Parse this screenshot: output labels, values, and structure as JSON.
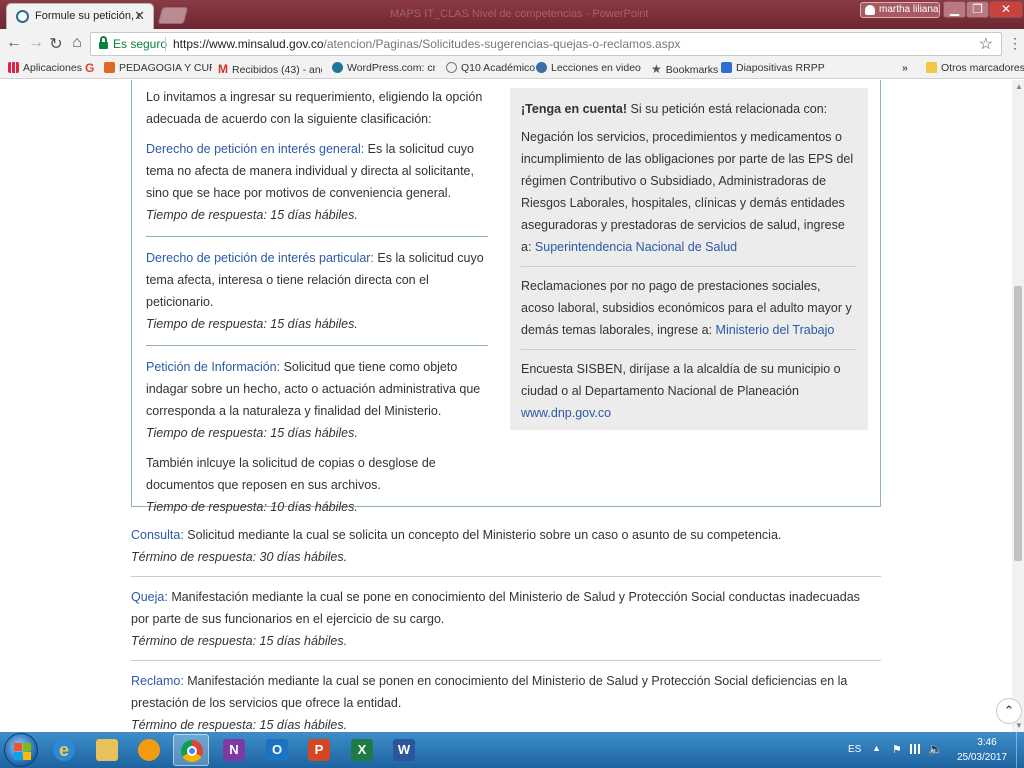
{
  "browser": {
    "tab_title": "Formule su petición, que",
    "tab_close": "✕",
    "window_ghost_text": "MAPS IT_CLAS Nivel de competencias - PowerPoint",
    "user_name": "martha liliana",
    "minimize": "▁",
    "maximize": "❐",
    "close": "✕",
    "back": "←",
    "forward": "→",
    "reload": "↻",
    "home": "⌂",
    "secure_label": "Es seguro",
    "url_host": "https://www.minsalud.gov.co",
    "url_path": "/atencion/Paginas/Solicitudes-sugerencias-quejas-o-reclamos.aspx",
    "star": "☆",
    "menu": "⋮"
  },
  "bookmarks": {
    "apps": "Aplicaciones",
    "google": "G",
    "pedagogia": "PEDAGOGIA Y CURRI",
    "gmail_icon": "M",
    "gmail": "Recibidos (43) - angel",
    "wordpress": "WordPress.com: crea",
    "q10": "Q10 Académico",
    "lecciones": "Lecciones en video - ",
    "bookmarks_icon": "★",
    "bookmarks": "Bookmarks",
    "diapositivas": "Diapositivas RRPP - la",
    "more": "»",
    "other": "Otros marcadores"
  },
  "left": {
    "intro": "Lo invitamos a ingresar su requerimiento, eligiendo la opción adecuada de acuerdo con la siguiente clasificación:",
    "general_link": "Derecho de petición en interés general:",
    "general_text": " Es la solicitud cuyo tema no afecta de manera individual y directa al solicitante, sino que se hace por motivos de conveniencia general.",
    "general_time": "Tiempo de respuesta: 15 días hábiles.",
    "particular_link": "Derecho de petición de interés particular:",
    "particular_text": " Es la solicitud cuyo tema afecta, interesa o tiene relación directa con el peticionario.",
    "particular_time": "Tiempo de respuesta: 15 días hábiles.",
    "info_link": "Petición de Información:",
    "info_text": " Solicitud que tiene como objeto indagar sobre un hecho, acto o actuación administrativa que corresponda a la naturaleza y finalidad del Ministerio.",
    "info_time": "Tiempo de respuesta: 15 días hábiles.",
    "copias_text": "También inlcuye la solicitud de copias o desglose de documentos que reposen en sus archivos.",
    "copias_time": "Tiempo de respuesta: 10 días hábiles."
  },
  "right": {
    "notice_bold": "¡Tenga en cuenta!",
    "notice_rest": " Si su petición está relacionada con:",
    "supersalud_text": "Negación los servicios, procedimientos y medicamentos o incumplimiento de las obligaciones por parte de las EPS del régimen Contributivo o Subsidiado, Administradoras de Riesgos Laborales, hospitales, clínicas y demás entidades aseguradoras y prestadoras de servicios de salud, ingrese a: ",
    "supersalud_link": "Superintendencia Nacional de Salud",
    "trabajo_text": "Reclamaciones por no pago de prestaciones sociales, acoso laboral, subsidios económicos para el adulto mayor y demás temas laborales, ingrese a: ",
    "trabajo_link": "Ministerio del Trabajo",
    "sisben_text": "Encuesta SISBEN, diríjase a la alcaldía de su municipio o ciudad o al Departamento Nacional de Planeación ",
    "sisben_link": "www.dnp.gov.co"
  },
  "definitions": {
    "consulta_link": "Consulta:",
    "consulta_text": " Solicitud mediante la cual se solicita un concepto del Ministerio sobre un caso o asunto de su competencia.",
    "consulta_time": "Término de respuesta: 30 días hábiles.",
    "queja_link": "Queja:",
    "queja_text": " Manifestación mediante la cual se pone en conocimiento del Ministerio de Salud y Protección Social conductas inadecuadas por parte de sus funcionarios en el ejercicio de su cargo.",
    "queja_time": "Término de respuesta: 15 días hábiles.",
    "reclamo_link": "Reclamo:",
    "reclamo_text": " Manifestación mediante la cual se ponen en conocimiento del Ministerio de Salud y Protección Social deficiencias en la prestación de los servicios que ofrece la entidad.",
    "reclamo_time": "Término de respuesta: 15 días hábiles."
  },
  "page": {
    "back_to_top": "⌃"
  },
  "taskbar": {
    "ie": "e",
    "onenote": "N",
    "outlook": "O",
    "ppt": "P",
    "excel": "X",
    "word": "W",
    "language": "ES",
    "tray_up": "▲",
    "flag": "⚑",
    "volume": "🔈",
    "time": "3:46",
    "date": "25/03/2017"
  },
  "colors": {
    "titlebar": "#7a2f39",
    "link": "#2b5aa8",
    "border": "#8fb3b8",
    "panel": "#ececec",
    "taskbar": "#2a74b4"
  }
}
